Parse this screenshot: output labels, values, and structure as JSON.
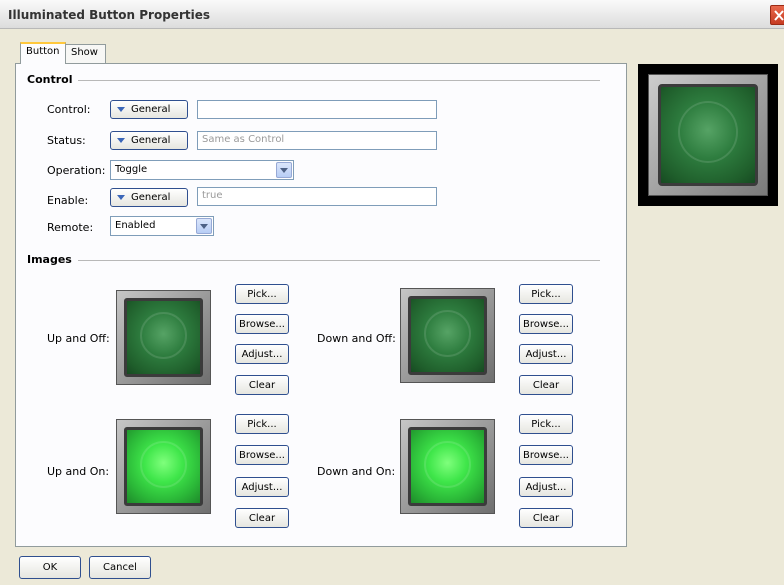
{
  "window": {
    "title": "Illuminated Button Properties"
  },
  "tabs": [
    {
      "label": "Button",
      "active": true
    },
    {
      "label": "Show",
      "active": false
    }
  ],
  "control_section": {
    "title": "Control",
    "control": {
      "label": "Control:",
      "button": "General",
      "value": ""
    },
    "status": {
      "label": "Status:",
      "button": "General",
      "placeholder": "Same as Control"
    },
    "operation": {
      "label": "Operation:",
      "value": "Toggle"
    },
    "enable": {
      "label": "Enable:",
      "button": "General",
      "placeholder": "true"
    },
    "remote": {
      "label": "Remote:",
      "value": "Enabled"
    }
  },
  "images_section": {
    "title": "Images",
    "items": [
      {
        "label": "Up and Off:",
        "state": "off"
      },
      {
        "label": "Down and Off:",
        "state": "off"
      },
      {
        "label": "Up and On:",
        "state": "on"
      },
      {
        "label": "Down and On:",
        "state": "on"
      }
    ],
    "buttons": {
      "pick": "Pick...",
      "browse": "Browse...",
      "adjust": "Adjust...",
      "clear": "Clear"
    }
  },
  "footer": {
    "ok": "OK",
    "cancel": "Cancel"
  },
  "icons": {
    "close": "close-icon",
    "general_dropdown": "triangle-down-icon",
    "select_dropdown": "chevron-down-icon"
  },
  "colors": {
    "accent": "#2f4f8f",
    "tab_highlight": "#ffc83c",
    "close": "#d14a2f"
  }
}
